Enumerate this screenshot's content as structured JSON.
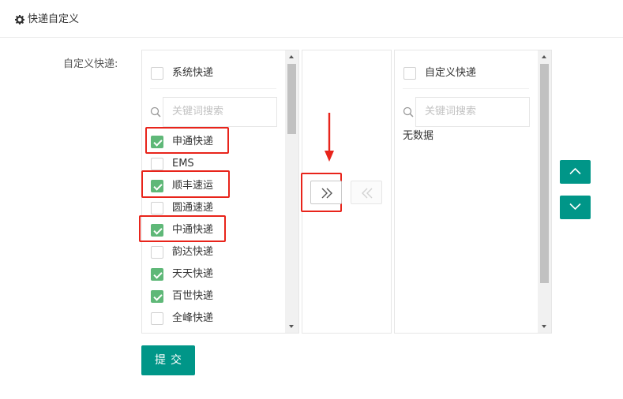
{
  "header": {
    "title": "快递自定义",
    "icon": "gear-icon"
  },
  "form": {
    "label": "自定义快递:"
  },
  "left_panel": {
    "select_all_label": "系统快递",
    "search_placeholder": "关键词搜索",
    "items": [
      {
        "label": "申通快递",
        "checked": true
      },
      {
        "label": "EMS",
        "checked": false
      },
      {
        "label": "顺丰速运",
        "checked": true
      },
      {
        "label": "圆通速递",
        "checked": false
      },
      {
        "label": "中通快递",
        "checked": true
      },
      {
        "label": "韵达快递",
        "checked": false
      },
      {
        "label": "天天快递",
        "checked": true
      },
      {
        "label": "百世快递",
        "checked": true
      },
      {
        "label": "全峰快递",
        "checked": false
      }
    ]
  },
  "transfer": {
    "to_right_icon": "double-chevron-right-icon",
    "to_left_icon": "double-chevron-left-icon"
  },
  "right_panel": {
    "select_all_label": "自定义快递",
    "search_placeholder": "关键词搜索",
    "empty_text": "无数据"
  },
  "order_buttons": {
    "up_icon": "chevron-up-icon",
    "down_icon": "chevron-down-icon"
  },
  "submit": {
    "label": "提交"
  },
  "colors": {
    "accent": "#009688",
    "checkbox_checked": "#5fb878",
    "highlight": "#e8241b"
  }
}
